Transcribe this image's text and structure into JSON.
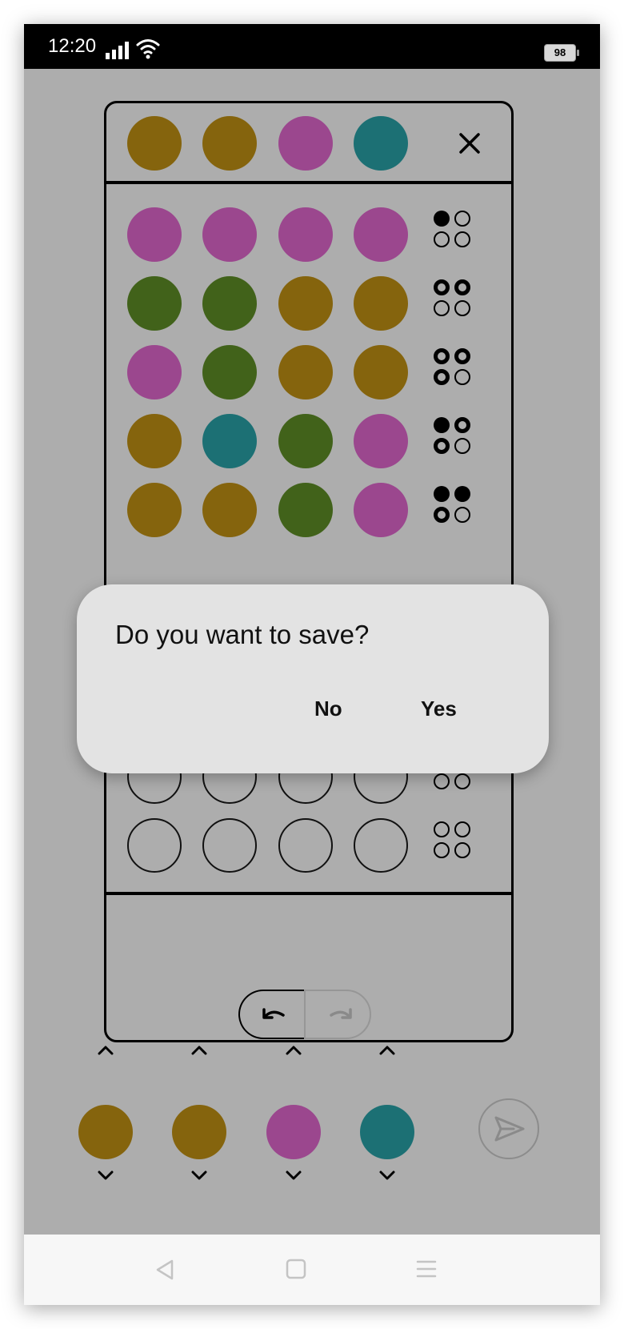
{
  "status_bar": {
    "time": "12:20",
    "battery": "98"
  },
  "colors": {
    "gold": "#85640d",
    "magenta": "#9b478e",
    "teal": "#1c7074",
    "green": "#41621a"
  },
  "secret_row": [
    "gold",
    "gold",
    "magenta",
    "teal"
  ],
  "guess_rows": [
    {
      "pegs": [
        "magenta",
        "magenta",
        "magenta",
        "magenta"
      ],
      "feedback": [
        "black",
        "none",
        "none",
        "none"
      ]
    },
    {
      "pegs": [
        "green",
        "green",
        "gold",
        "gold"
      ],
      "feedback": [
        "white",
        "white",
        "none",
        "none"
      ]
    },
    {
      "pegs": [
        "magenta",
        "green",
        "gold",
        "gold"
      ],
      "feedback": [
        "white",
        "white",
        "white",
        "none"
      ]
    },
    {
      "pegs": [
        "gold",
        "teal",
        "green",
        "magenta"
      ],
      "feedback": [
        "black",
        "white",
        "white",
        "none"
      ]
    },
    {
      "pegs": [
        "gold",
        "gold",
        "green",
        "magenta"
      ],
      "feedback": [
        "black",
        "black",
        "white",
        "none"
      ]
    }
  ],
  "empty_rows": 3,
  "current_selection": [
    "gold",
    "gold",
    "magenta",
    "teal"
  ],
  "dialog": {
    "title": "Do you want to save?",
    "no_label": "No",
    "yes_label": "Yes"
  },
  "icons": {
    "close": "close-icon",
    "undo": "undo-icon",
    "redo": "redo-icon",
    "send": "send-icon"
  }
}
